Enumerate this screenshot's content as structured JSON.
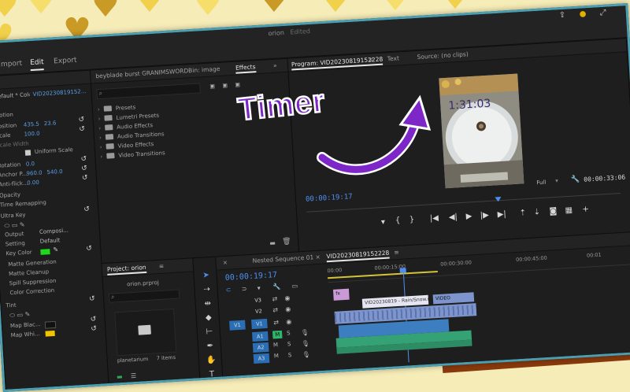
{
  "window": {
    "title": "orion",
    "status": "Edited"
  },
  "workspace_tabs": [
    "Import",
    "Edit",
    "Export"
  ],
  "effect_controls": {
    "clip_source": "Default * Color Mat...",
    "clip_target": "VID20230819152...",
    "rows": [
      {
        "label": "Motion"
      },
      {
        "label": "Position",
        "v1": "435.5",
        "v2": "23.6"
      },
      {
        "label": "Scale",
        "v1": "100.0"
      },
      {
        "label": "Scale Width"
      },
      {
        "label": "Uniform Scale"
      },
      {
        "label": "Rotation",
        "v1": "0.0"
      },
      {
        "label": "Anchor P...",
        "v1": "960.0",
        "v2": "540.0"
      },
      {
        "label": "Anti-flick...",
        "v1": "0.00"
      },
      {
        "label": "Opacity"
      },
      {
        "label": "Time Remapping"
      },
      {
        "label": "Ultra Key"
      },
      {
        "label": "Output",
        "value": "Composi..."
      },
      {
        "label": "Setting",
        "value": "Default"
      },
      {
        "label": "Key Color"
      },
      {
        "label": "Matte Generation"
      },
      {
        "label": "Matte Cleanup"
      },
      {
        "label": "Spill Suppression"
      },
      {
        "label": "Color Correction"
      },
      {
        "label": "Tint"
      },
      {
        "label": "Map Blac..."
      },
      {
        "label": "Map Whi..."
      }
    ]
  },
  "effects_panel": {
    "tabs": [
      "beyblade burst GRANIMSWORD",
      "Bin: image",
      "Effects"
    ],
    "items": [
      "Presets",
      "Lumetri Presets",
      "Audio Effects",
      "Audio Transitions",
      "Video Effects",
      "Video Transitions"
    ]
  },
  "program_monitor": {
    "title": "Program: VID20230819152228",
    "tabs": [
      "Text",
      "Source: (no clips)"
    ],
    "overlay_timer": "1:31:03",
    "current_time": "00:00:19:17",
    "duration": "00:00:33:06",
    "zoom": "Full"
  },
  "callout": {
    "text": "Timer"
  },
  "project_panel": {
    "title": "Project: orion",
    "file": "orion.prproj",
    "item_name": "planetarium",
    "item_info": "7 items"
  },
  "timeline": {
    "title": "Nested Sequence 01",
    "sequence": "VID20230819152228",
    "current_time": "00:00:19:17",
    "ruler": [
      "00:00",
      "00:00:15:00",
      "00:00:30:00",
      "00:00:45:00",
      "00:01"
    ],
    "video_tracks": [
      "V3",
      "V2",
      "V1"
    ],
    "audio_tracks": [
      "A1",
      "A2",
      "A3"
    ],
    "source_label": "V1",
    "clips": [
      {
        "label": "fx"
      },
      {
        "label": "VID20230819 - Rain/Snow.mp4"
      },
      {
        "label": "VIDEO"
      }
    ]
  },
  "colors": {
    "timecode_blue": "#4d8ff0",
    "purple_callout": "#7d27c8",
    "clip_violet": "#c99ad6",
    "clip_blue": "#7d94cc",
    "clip_green": "#35a276",
    "frame_border": "#4a9fb2"
  }
}
